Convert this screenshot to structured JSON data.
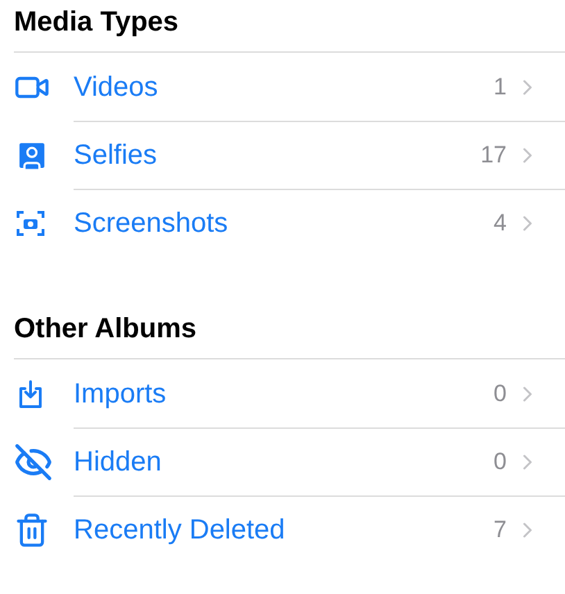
{
  "sections": [
    {
      "title": "Media Types",
      "items": [
        {
          "kind": "video",
          "label": "Videos",
          "count": "1"
        },
        {
          "kind": "selfie",
          "label": "Selfies",
          "count": "17"
        },
        {
          "kind": "screenshot",
          "label": "Screenshots",
          "count": "4"
        }
      ]
    },
    {
      "title": "Other Albums",
      "items": [
        {
          "kind": "import",
          "label": "Imports",
          "count": "0"
        },
        {
          "kind": "hidden",
          "label": "Hidden",
          "count": "0"
        },
        {
          "kind": "trash",
          "label": "Recently Deleted",
          "count": "7"
        }
      ]
    }
  ]
}
